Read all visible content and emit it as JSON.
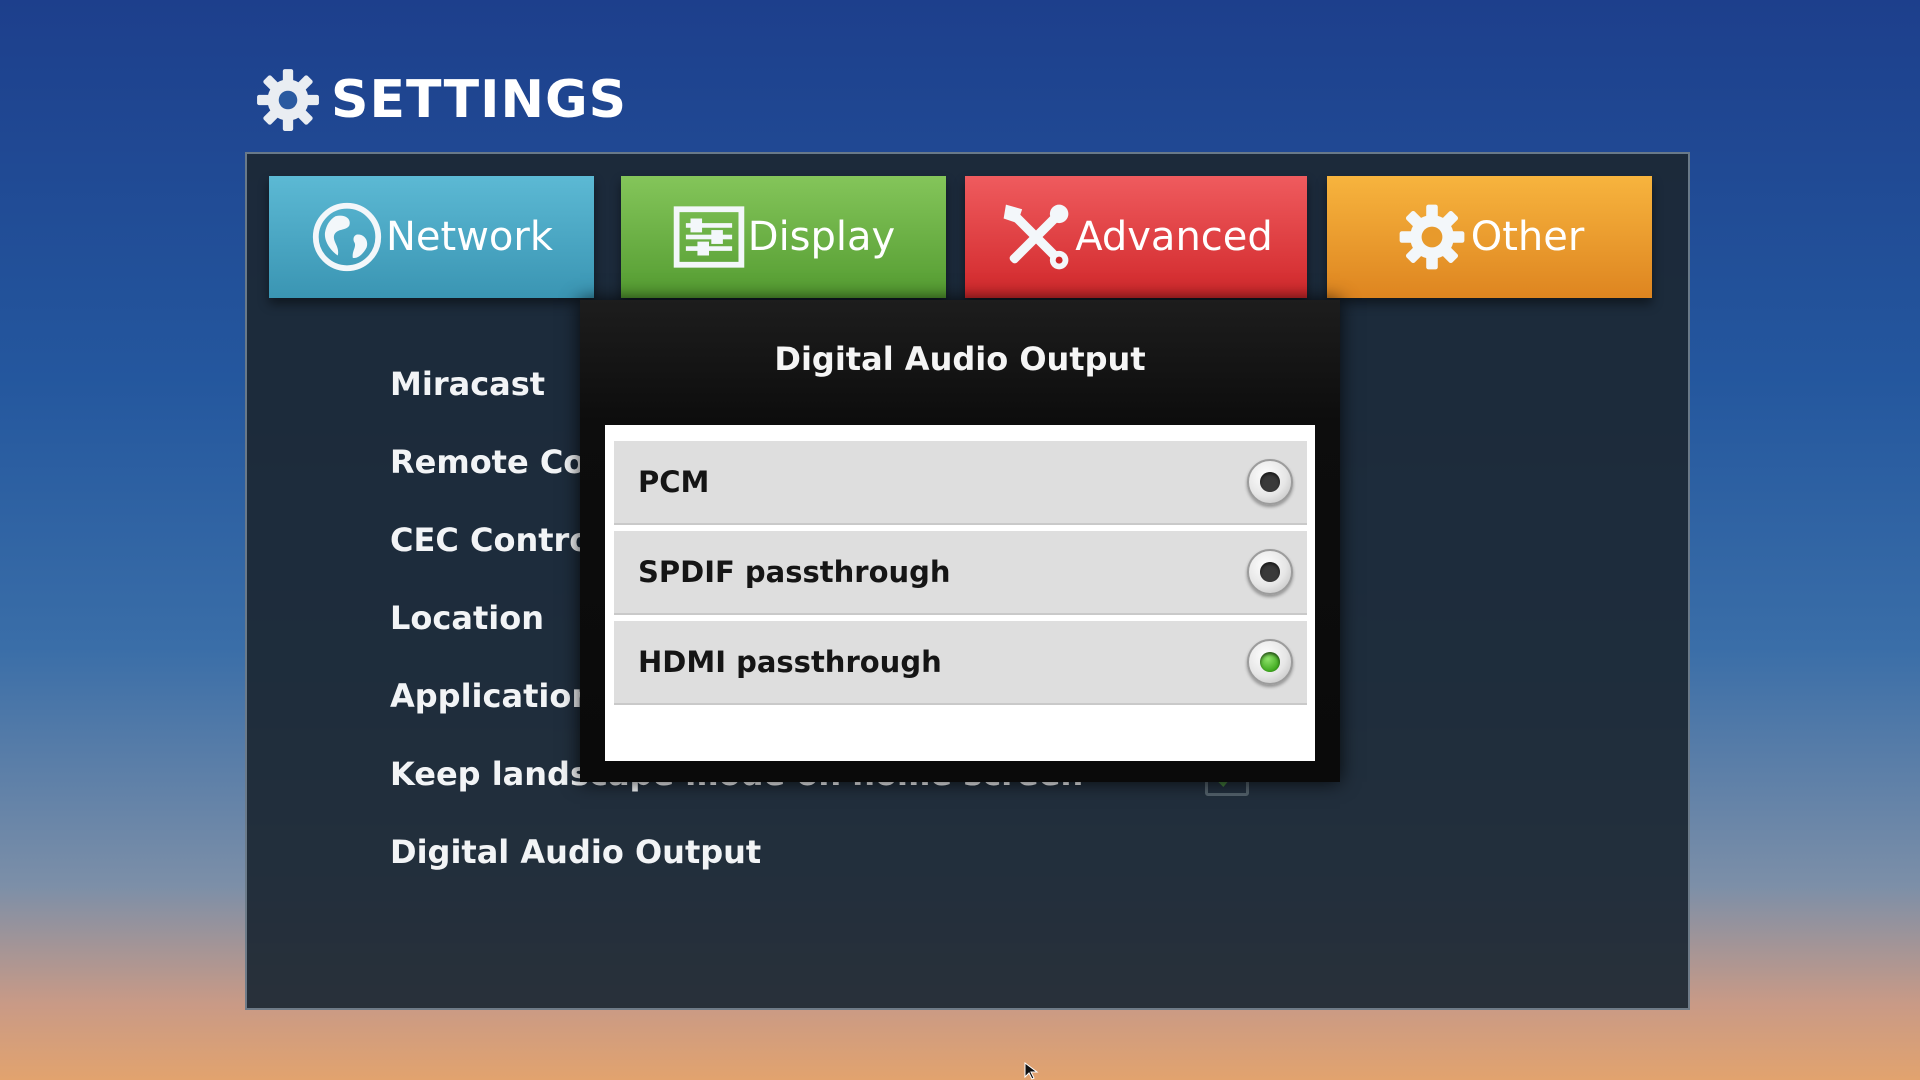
{
  "header": {
    "title": "SETTINGS",
    "icon": "gear-icon"
  },
  "tabs": [
    {
      "label": "Network",
      "icon": "globe-icon",
      "color": "#3a95b3"
    },
    {
      "label": "Display",
      "icon": "display-sliders-icon",
      "color": "#549c31"
    },
    {
      "label": "Advanced",
      "icon": "tools-icon",
      "color": "#d1282b"
    },
    {
      "label": "Other",
      "icon": "gear-icon",
      "color": "#de8520"
    }
  ],
  "settings": {
    "items": [
      "Miracast",
      "Remote Control",
      "CEC Control",
      "Location",
      "Application requests",
      "Keep landscape mode on home screen",
      "Digital Audio Output"
    ],
    "keep_landscape_checked": true
  },
  "dialog": {
    "title": "Digital Audio Output",
    "options": [
      {
        "label": "PCM",
        "selected": false
      },
      {
        "label": "SPDIF passthrough",
        "selected": false
      },
      {
        "label": "HDMI passthrough",
        "selected": true
      }
    ],
    "selected_color": "#3fa91e"
  }
}
